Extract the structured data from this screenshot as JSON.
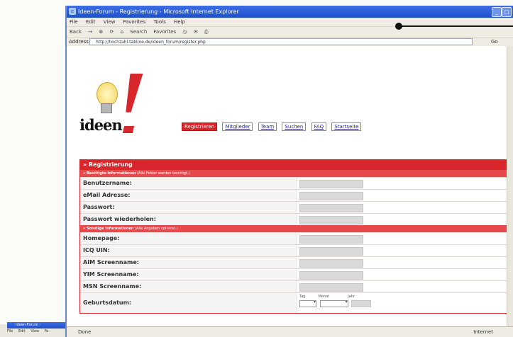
{
  "window": {
    "title": "Ideen-Forum - Registrierung - Microsoft Internet Explorer",
    "controls": [
      "_",
      "□"
    ]
  },
  "menubar": [
    "File",
    "Edit",
    "View",
    "Favorites",
    "Tools",
    "Help"
  ],
  "toolbar": [
    "Back",
    "→",
    "⊗",
    "⟳",
    "⌂",
    "Search",
    "Favorites",
    "◷",
    "✉",
    "⎙"
  ],
  "address": {
    "label": "Address",
    "url": "http://hochzahl.tabline.de/ideen_forum/register.php",
    "go": "Go"
  },
  "logo": {
    "word": "ideen"
  },
  "nav": [
    "Registrieren",
    "Mitglieder",
    "Team",
    "Suchen",
    "FAQ",
    "Startseite"
  ],
  "form": {
    "header": "» Registrierung",
    "required": {
      "title": "» Benötigte Informationen",
      "note": "(Alle Felder werden benötigt.)",
      "fields": [
        "Benutzername:",
        "eMail Adresse:",
        "Passwort:",
        "Passwort wiederholen:"
      ]
    },
    "optional": {
      "title": "» Sonstige Informationen",
      "note": "(Alle Angaben optional.)",
      "fields": [
        "Homepage:",
        "ICQ UIN:",
        "AIM Screenname:",
        "YIM Screenname:",
        "MSN Screenname:"
      ]
    },
    "dob": {
      "label": "Geburtsdatum:",
      "tag": "Tag",
      "monat": "Monat",
      "jahr": "Jahr"
    }
  },
  "status": {
    "text": "Done",
    "zone": "Internet"
  },
  "taskbar": {
    "title": "Ideen-Forum -",
    "menu": [
      "File",
      "Edit",
      "View",
      "Fa"
    ]
  }
}
